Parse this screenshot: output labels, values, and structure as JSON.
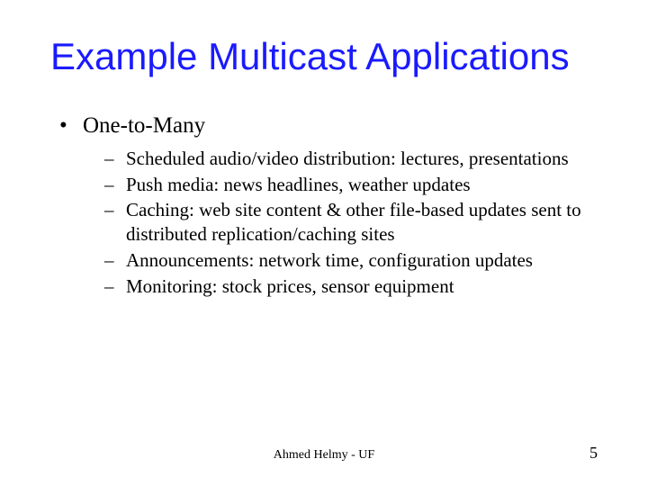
{
  "title": "Example Multicast Applications",
  "body": {
    "level1_label": "One-to-Many",
    "items": [
      "Scheduled audio/video distribution: lectures, presentations",
      "Push media: news headlines, weather updates",
      "Caching: web site content & other file-based updates sent to distributed replication/caching sites",
      "Announcements: network time, configuration updates",
      "Monitoring: stock prices, sensor equipment"
    ]
  },
  "footer": {
    "center": "Ahmed Helmy - UF",
    "page_number": "5"
  }
}
